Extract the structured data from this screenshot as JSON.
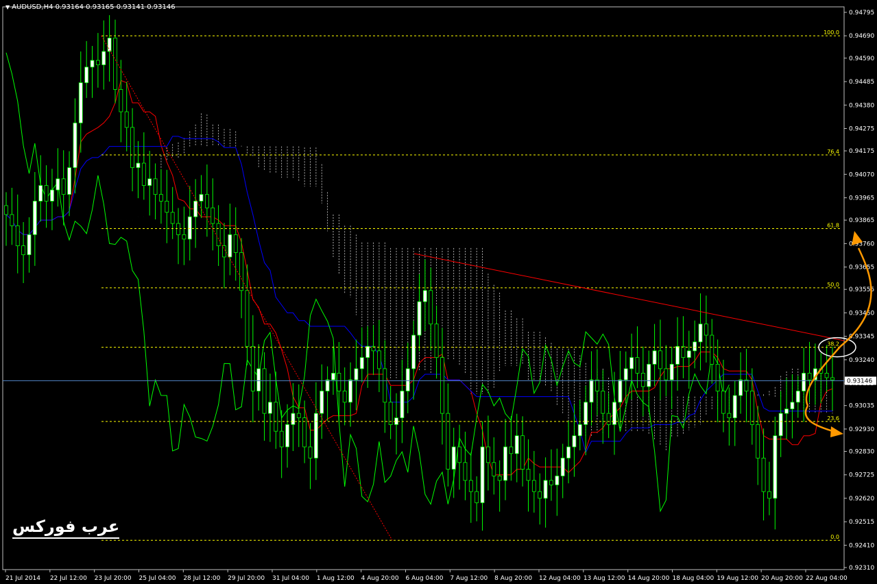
{
  "header": {
    "symbol": "AUDUSD,H4",
    "ohlc": "0.93164 0.93165 0.93141 0.93146"
  },
  "watermark": "عرب فوركس",
  "chart_data": {
    "type": "candlestick",
    "symbol": "AUDUSD",
    "timeframe": "H4",
    "current_price": 0.93146,
    "y_range": [
      0.9231,
      0.94795
    ],
    "price_ticks": [
      "0.94795",
      "0.94690",
      "0.94590",
      "0.94485",
      "0.94380",
      "0.94275",
      "0.94175",
      "0.94070",
      "0.93965",
      "0.93865",
      "0.93760",
      "0.93655",
      "0.93555",
      "0.93450",
      "0.93345",
      "0.93240",
      "0.93135",
      "0.93035",
      "0.92930",
      "0.92830",
      "0.92725",
      "0.92620",
      "0.92515",
      "0.92410",
      "0.92310"
    ],
    "time_labels": [
      "21 Jul 2014",
      "22 Jul 12:00",
      "23 Jul 20:00",
      "25 Jul 04:00",
      "28 Jul 12:00",
      "29 Jul 20:00",
      "31 Jul 04:00",
      "1 Aug 12:00",
      "4 Aug 20:00",
      "6 Aug 04:00",
      "7 Aug 12:00",
      "8 Aug 20:00",
      "12 Aug 04:00",
      "13 Aug 12:00",
      "14 Aug 20:00",
      "18 Aug 04:00",
      "19 Aug 12:00",
      "20 Aug 20:00",
      "22 Aug 04:00"
    ],
    "fibonacci": [
      {
        "label": "100.0",
        "price": 0.9469
      },
      {
        "label": "76.4",
        "price": 0.94157
      },
      {
        "label": "61.8",
        "price": 0.93827
      },
      {
        "label": "50.0",
        "price": 0.93562
      },
      {
        "label": "38.2",
        "price": 0.93296
      },
      {
        "label": "23.6",
        "price": 0.92964
      },
      {
        "label": "0.0",
        "price": 0.92432
      }
    ],
    "colors": {
      "background": "#000000",
      "bull_candle": "#ffffff",
      "bear_candle": "#000000",
      "wick": "#00ff00",
      "tenkan": "#ff0000",
      "kijun": "#0000ff",
      "chikou": "#00ff00",
      "cloud": "#ffffff",
      "fib": "#ffff00",
      "trendline": "#ff0000",
      "annotation": "#ff9900",
      "current_price_line": "#4f7fbf"
    },
    "candles_close": [
      0.9389,
      0.9384,
      0.9375,
      0.9371,
      0.938,
      0.9395,
      0.9402,
      0.9395,
      0.94,
      0.9405,
      0.9398,
      0.941,
      0.943,
      0.9448,
      0.9455,
      0.9458,
      0.9456,
      0.9462,
      0.9468,
      0.9445,
      0.9435,
      0.9428,
      0.941,
      0.9412,
      0.9402,
      0.9405,
      0.9398,
      0.9395,
      0.939,
      0.9385,
      0.938,
      0.9378,
      0.9388,
      0.9395,
      0.9398,
      0.9392,
      0.9385,
      0.9375,
      0.937,
      0.938,
      0.9372,
      0.9355,
      0.933,
      0.931,
      0.932,
      0.93,
      0.9305,
      0.9292,
      0.9285,
      0.9295,
      0.93,
      0.9298,
      0.9285,
      0.928,
      0.93,
      0.931,
      0.9315,
      0.9318,
      0.931,
      0.9305,
      0.9315,
      0.932,
      0.9325,
      0.933,
      0.9328,
      0.932,
      0.9305,
      0.9295,
      0.9298,
      0.931,
      0.932,
      0.9335,
      0.935,
      0.9355,
      0.934,
      0.9325,
      0.93,
      0.9275,
      0.9285,
      0.9278,
      0.927,
      0.9265,
      0.926,
      0.9285,
      0.9278,
      0.9272,
      0.927,
      0.9285,
      0.9282,
      0.929,
      0.9275,
      0.927,
      0.9265,
      0.9262,
      0.927,
      0.9268,
      0.9272,
      0.928,
      0.9285,
      0.929,
      0.9295,
      0.9305,
      0.9315,
      0.931,
      0.93,
      0.9295,
      0.9305,
      0.9315,
      0.932,
      0.9325,
      0.9318,
      0.9312,
      0.9322,
      0.9328,
      0.932,
      0.9315,
      0.9322,
      0.933,
      0.9325,
      0.9328,
      0.9332,
      0.934,
      0.9335,
      0.9322,
      0.931,
      0.93,
      0.9298,
      0.9308,
      0.9315,
      0.931,
      0.9295,
      0.928,
      0.9265,
      0.9262,
      0.929,
      0.93,
      0.9302,
      0.9305,
      0.931,
      0.9318,
      0.9315,
      0.932,
      0.9318,
      0.9316,
      0.9315
    ]
  }
}
